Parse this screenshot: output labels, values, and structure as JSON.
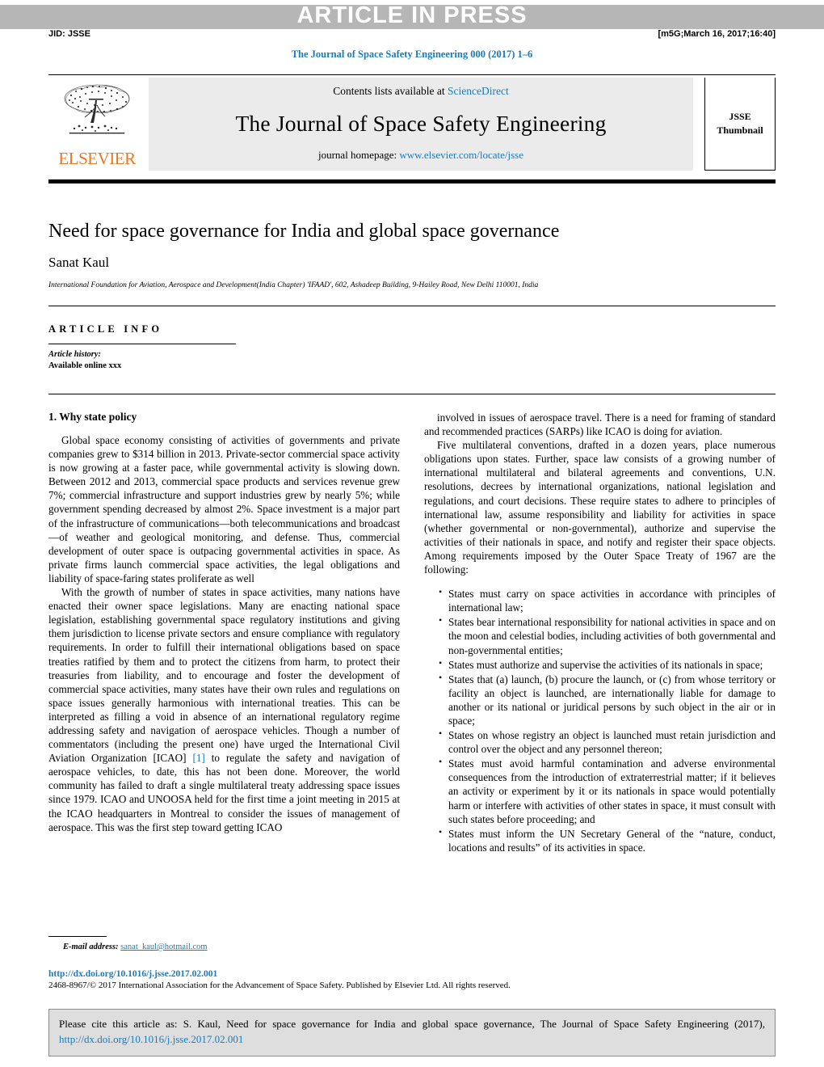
{
  "banner": {
    "press_label": "ARTICLE IN PRESS",
    "jid": "JID: JSSE",
    "timestamp": "[m5G;March 16, 2017;16:40]",
    "running_head": "The Journal of Space Safety Engineering 000 (2017) 1–6"
  },
  "masthead": {
    "publisher": "ELSEVIER",
    "contents_prefix": "Contents lists available at ",
    "contents_link": "ScienceDirect",
    "journal_name": "The Journal of Space Safety Engineering",
    "homepage_prefix": "journal homepage: ",
    "homepage_link": "www.elsevier.com/locate/jsse",
    "thumbnail_line1": "JSSE",
    "thumbnail_line2": "Thumbnail"
  },
  "article": {
    "title": "Need for space governance for India and global space governance",
    "author": "Sanat Kaul",
    "affiliation": "International Foundation for Aviation, Aerospace and Development(India Chapter) 'IFAAD', 602, Ashadeep Building, 9-Hailey Road, New Delhi 110001, India"
  },
  "article_info": {
    "heading": "ARTICLE INFO",
    "history_label": "Article history:",
    "history_value": "Available online xxx"
  },
  "section": {
    "heading": "1. Why state policy"
  },
  "left_column": {
    "paragraphs": [
      "Global space economy consisting of activities of governments and private companies grew to $314 billion in 2013. Private-sector commercial space activity is now growing at a faster pace, while governmental activity is slowing down. Between 2012 and 2013, commercial space products and services revenue grew 7%; commercial infrastructure and support industries grew by nearly 5%; while government spending decreased by almost 2%. Space investment is a major part of the infrastructure of communications—both telecommunications and broadcast—of weather and geological monitoring, and defense. Thus, commercial development of outer space is outpacing governmental activities in space. As private firms launch commercial space activities, the legal obligations and liability of space-faring states proliferate as well"
    ],
    "paragraph2_pre": "With the growth of number of states in space activities, many nations have enacted their owner space legislations. Many are enacting national space legislation, establishing governmental space regulatory institutions and giving them jurisdiction to license private sectors and ensure compliance with regulatory requirements. In order to fulfill their international obligations based on space treaties ratified by them and to protect the citizens from harm, to protect their treasuries from liability, and to encourage and foster the development of commercial space activities, many states have their own rules and regulations on space issues generally harmonious with international treaties. This can be interpreted as filling a void in absence of an international regulatory regime addressing safety and navigation of aerospace vehicles. Though a number of commentators (including the present one) have urged the International Civil Aviation Organization [ICAO] ",
    "paragraph2_ref": "[1]",
    "paragraph2_post": " to regulate the safety and navigation of aerospace vehicles, to date, this has not been done. Moreover, the world community has failed to draft a single multilateral treaty addressing space issues since 1979. ICAO and UNOOSA held for the first time a joint meeting in 2015 at the ICAO headquarters in Montreal to consider the issues of management of aerospace. This was the first step toward getting ICAO"
  },
  "right_column": {
    "paragraphs": [
      "involved in issues of aerospace travel. There is a need for framing of standard and recommended practices (SARPs) like ICAO is doing for aviation.",
      "Five multilateral conventions, drafted in a dozen years, place numerous obligations upon states. Further, space law consists of a growing number of international multilateral and bilateral agreements and conventions, U.N. resolutions, decrees by international organizations, national legislation and regulations, and court decisions. These require states to adhere to principles of international law, assume responsibility and liability for activities in space (whether governmental or non-governmental), authorize and supervise the activities of their nationals in space, and notify and register their space objects. Among requirements imposed by the Outer Space Treaty of 1967 are the following:"
    ],
    "requirements": [
      "States must carry on space activities in accordance with principles of international law;",
      "States bear international responsibility for national activities in space and on the moon and celestial bodies, including activities of both governmental and non-governmental entities;",
      "States must authorize and supervise the activities of its nationals in space;",
      "States that (a) launch, (b) procure the launch, or (c) from whose territory or facility an object is launched, are internationally liable for damage to another or its national or juridical persons by such object in the air or in space;",
      "States on whose registry an object is launched must retain jurisdiction and control over the object and any personnel thereon;",
      "States must avoid harmful contamination and adverse environmental consequences from the introduction of extraterrestrial matter; if it believes an activity or experiment by it or its nationals in space would potentially harm or interfere with activities of other states in space, it must consult with such states before proceeding; and",
      "States must inform the UN Secretary General of the “nature, conduct, locations and results” of its activities in space."
    ]
  },
  "footnote": {
    "label": "E-mail address:",
    "email": "sanat_kaul@hotmail.com"
  },
  "copyright": {
    "doi": "http://dx.doi.org/10.1016/j.jsse.2017.02.001",
    "rights": "2468-8967/© 2017 International Association for the Advancement of Space Safety. Published by Elsevier Ltd. All rights reserved."
  },
  "cite_box": {
    "text_pre": "Please cite this article as: S. Kaul, Need for space governance for India and global space governance, The Journal of Space Safety Engineering (2017), ",
    "link": "http://dx.doi.org/10.1016/j.jsse.2017.02.001"
  },
  "colors": {
    "link_blue": "#1a7bb9",
    "elsevier_orange": "#e87722",
    "band_gray": "#b6b6b6",
    "cite_bg": "#dedede"
  }
}
